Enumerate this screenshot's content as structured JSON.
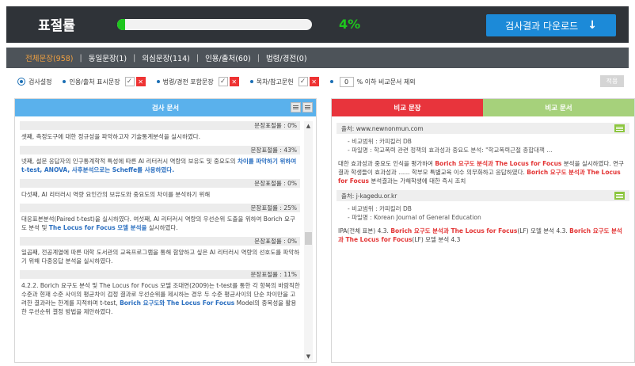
{
  "header": {
    "title": "표절률",
    "progress_fraction": 0.04,
    "percent": "4%",
    "download_label": "검사결과 다운로드",
    "download_icon": "download-arrow-icon",
    "colors": {
      "bar": "#2f3338",
      "accent": "#1ec61e",
      "download": "#1c8ad8"
    }
  },
  "tabs": [
    {
      "label": "전체문장(958)"
    },
    {
      "label": "동일문장(1)"
    },
    {
      "label": "의심문장(114)"
    },
    {
      "label": "인용/출처(60)"
    },
    {
      "label": "법령/경전(0)"
    }
  ],
  "options": {
    "settings_label": "검사설정",
    "opt1": "인용/출처 표시문장",
    "opt2": "법령/경전 포함문장",
    "opt3": "목차/참고문헌",
    "percent_value": "0",
    "exclude_label": "% 이하 비교문서 제외",
    "apply_label": "적용"
  },
  "left_panel": {
    "title": "검사 문서",
    "sentences": [
      {
        "rate": "문장표절률 : 0%",
        "parts": [
          {
            "t": "셋째, 측정도구에 대한 정규성을 파악하고자 기술통계분석을 실시하였다."
          }
        ]
      },
      {
        "rate": "문장표절률 : 43%",
        "parts": [
          {
            "t": "넷째, 설문 응답자의 인구통계학적 특성에 따른 AI 리터러시 역량의 보유도 및 중요도의 "
          },
          {
            "t": "차이를 파악하기 위하여 t-test, ANOVA, 사후분석으로는 Scheffe를 사용하였다.",
            "hl": true
          }
        ]
      },
      {
        "rate": "문장표절률 : 0%",
        "parts": [
          {
            "t": "다섯째, AI 리터러시 역량 요인간의 보유도와 중요도의 차이를 분석하기 위해"
          }
        ]
      },
      {
        "rate": "문장표절률 : 25%",
        "parts": [
          {
            "t": "대응표본분석(Paired t-test)을 실시하였다. 여섯째, AI 리터러시 역량의 우선순위 도출을 위하여 Borich 요구도 분석 및 "
          },
          {
            "t": "The Locus for Focus 모델 분석을",
            "hl": true
          },
          {
            "t": " 실시하였다."
          }
        ]
      },
      {
        "rate": "문장표절률 : 0%",
        "parts": [
          {
            "t": "일곱째, 전공계열에 따른 대학 도서관의 교육프로그램을 통해 함양하고 싶은 AI 리터러시 역량의 선호도를 파악하기 위해 다중응답 분석을 실시하였다."
          }
        ]
      },
      {
        "rate": "문장표절률 : 11%",
        "parts": [
          {
            "t": "4.2.2. Borich 요구도 분석 및 The Locus for Focus 모델 조대연(2009)는 t-test를 통한 각 항목의 바람직한 수준과 현재 수준 사이의 평균차이 검정 결과로 우선순위를 제시하는 경우 두 수준 평균사이의 단순 차이만을 고려한 결과라는 한계를 지적하며 t-test, "
          },
          {
            "t": "Borich 요구도와 The Locus For Focus",
            "hl": true
          },
          {
            "t": " Model의 중복성을 활용한 우선순위 결정 방법을 제안하였다."
          }
        ]
      }
    ]
  },
  "right_panel": {
    "tab_compare_sentence": "비교 문장",
    "tab_compare_doc": "비교 문서",
    "sources": [
      {
        "source": "출처: www.newnonmun.com",
        "meta": [
          "- 비교범위 : 카피킬러 DB",
          "- 파일명 : 학교폭력 관련 정책의 효과성과 중요도 분석: \"학교폭력근절 종합대책 ..."
        ],
        "parts": [
          {
            "t": "대한 효과성과 중요도 인식을 평가하여 "
          },
          {
            "t": "Borich 요구도 분석과 The Locus for Focus",
            "hl": true
          },
          {
            "t": " 분석을 실시하였다. 연구결과 학생들이 효과성과 ...... 학부모 특별교육 이수 의무화하고 응답하였다. "
          },
          {
            "t": "Borich 요구도 분석과 The Locus for Focus",
            "hl": true
          },
          {
            "t": " 분석결과는 가해학생에 대한 즉시 조치"
          }
        ]
      },
      {
        "source": "출처: j-kagedu.or.kr",
        "meta": [
          "- 비교범위 : 카피킬러 DB",
          "- 파일명 : Korean Journal of General Education"
        ],
        "parts": [
          {
            "t": "IPA(전체 표본) 4.3. "
          },
          {
            "t": "Borich 요구도 분석과 The Locus for Focus",
            "hl": true
          },
          {
            "t": "(LF) 모델 분석 4.3. "
          },
          {
            "t": "Borich 요구도 분석과 The Locus for Focus",
            "hl": true
          },
          {
            "t": "(LF) 모델 분석 4.3"
          }
        ]
      }
    ]
  }
}
